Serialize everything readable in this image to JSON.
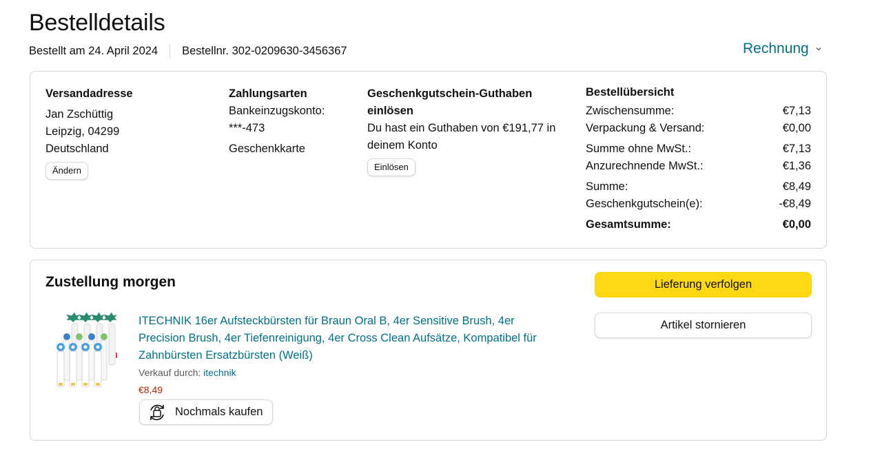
{
  "page": {
    "title": "Bestelldetails",
    "ordered_on": "Bestellt am 24. April 2024",
    "order_number": "Bestellnr. 302-0209630-3456367",
    "invoice_label": "Rechnung"
  },
  "shipping": {
    "heading": "Versandadresse",
    "name": "Jan Zschüttig",
    "city": "Leipzig, 04299",
    "country": "Deutschland",
    "change_label": "Ändern"
  },
  "payment": {
    "heading": "Zahlungsarten",
    "method_line1": "Bankeinzugskonto:",
    "method_line2": "***-473",
    "method_other": "Geschenkkarte"
  },
  "giftcard": {
    "heading_line1": "Geschenkgutschein-Guthaben",
    "heading_line2": "einlösen",
    "text_line1": "Du hast ein Guthaben von €191,77 in",
    "text_line2": "deinem Konto",
    "redeem_label": "Einlösen"
  },
  "summary": {
    "heading": "Bestellübersicht",
    "rows": [
      {
        "label": "Zwischensumme:",
        "value": "€7,13"
      },
      {
        "label": "Verpackung & Versand:",
        "value": "€0,00"
      },
      {
        "label": "Summe ohne MwSt.:",
        "value": "€7,13"
      },
      {
        "label": "Anzurechnende MwSt.:",
        "value": "€1,36"
      },
      {
        "label": "Summe:",
        "value": "€8,49"
      },
      {
        "label": "Geschenkgutschein(e):",
        "value": "-€8,49"
      }
    ],
    "total_label": "Gesamtsumme:",
    "total_value": "€0,00"
  },
  "delivery": {
    "status": "Zustellung morgen",
    "track_label": "Lieferung verfolgen",
    "cancel_label": "Artikel stornieren"
  },
  "product": {
    "title_line1": "ITECHNIK 16er Aufsteckbürsten für Braun Oral B, 4er Sensitive Brush, 4er",
    "title_line2": "Precision Brush, 4er Tiefenreinigung, 4er Cross Clean Aufsätze, Kompatibel für",
    "title_line3": "Zahnbürsten Ersatzbürsten (Weiß)",
    "sold_by_label": "Verkauf durch: ",
    "seller": "itechnik",
    "price": "€8,49",
    "rebuy_label": "Nochmals kaufen",
    "rebuy_icon": "buy-again-icon"
  },
  "colors": {
    "link": "#007185",
    "price": "#b12704",
    "primary_button": "#ffd814"
  }
}
